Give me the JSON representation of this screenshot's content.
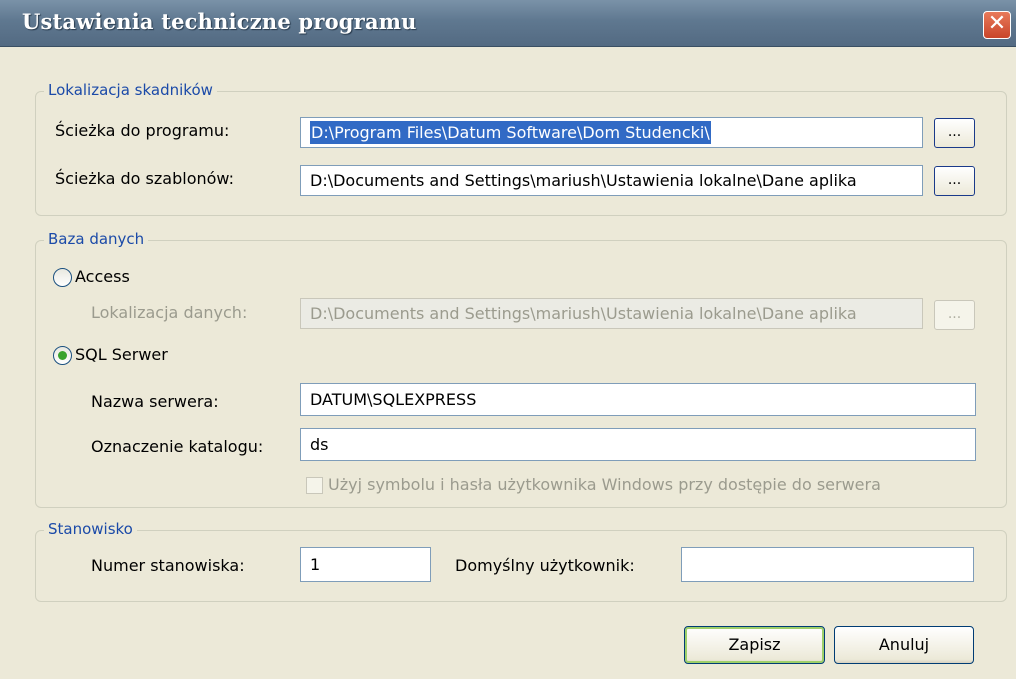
{
  "window": {
    "title": "Ustawienia techniczne programu",
    "close_glyph": "✕"
  },
  "components": {
    "legend": "Lokalizacja skadników",
    "program_path_label": "Ścieżka do programu:",
    "program_path_value": "D:\\Program Files\\Datum Software\\Dom Studencki\\",
    "templates_path_label": "Ścieżka do szablonów:",
    "templates_path_value": "D:\\Documents and Settings\\mariush\\Ustawienia lokalne\\Dane aplika",
    "browse_label": "..."
  },
  "database": {
    "legend": "Baza danych",
    "access_label": "Access",
    "access_selected": false,
    "data_location_label": "Lokalizacja danych:",
    "data_location_value": "D:\\Documents and Settings\\mariush\\Ustawienia lokalne\\Dane aplika",
    "browse_label": "...",
    "sql_label": "SQL Serwer",
    "sql_selected": true,
    "server_name_label": "Nazwa serwera:",
    "server_name_value": "DATUM\\SQLEXPRESS",
    "catalog_label": "Oznaczenie katalogu:",
    "catalog_value": "ds",
    "windows_auth_label": "Użyj symbolu i hasła użytkownika Windows przy dostępie do serwera",
    "windows_auth_checked": false
  },
  "workstation": {
    "legend": "Stanowisko",
    "number_label": "Numer stanowiska:",
    "number_value": "1",
    "default_user_label": "Domyślny użytkownik:",
    "default_user_value": ""
  },
  "buttons": {
    "save": "Zapisz",
    "cancel": "Anuluj"
  },
  "icons": {
    "close": "close-icon",
    "browse": "ellipsis-icon"
  }
}
